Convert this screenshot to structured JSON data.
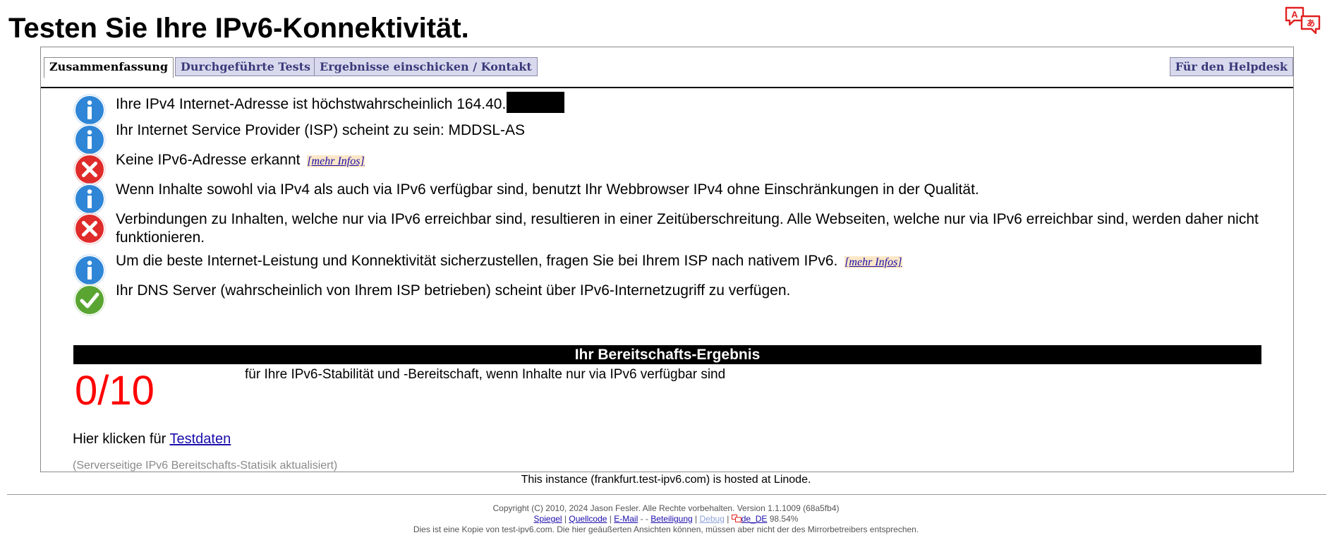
{
  "page": {
    "title": "Testen Sie Ihre IPv6-Konnektivität."
  },
  "icons": {
    "info": "info-icon",
    "error": "error-icon",
    "ok": "check-icon",
    "translate": "translate-icon"
  },
  "colors": {
    "info_blue": "#2f86d6",
    "error_red": "#e02b2b",
    "ok_green": "#5aa532",
    "score_red": "#ff0000",
    "tab_bg": "#d9d9ee",
    "tab_text": "#3a3a7a"
  },
  "tabs": [
    {
      "label": "Zusammenfassung",
      "active": true
    },
    {
      "label": "Durchgeführte Tests",
      "active": false
    },
    {
      "label": "Ergebnisse einschicken / Kontakt",
      "active": false
    }
  ],
  "helpdesk_tab": {
    "label": "Für den Helpdesk"
  },
  "results": [
    {
      "status": "info",
      "text": "Ihre IPv4 Internet-Adresse ist höchstwahrscheinlich 164.40."
    },
    {
      "status": "info",
      "text": "Ihr Internet Service Provider (ISP) scheint zu sein: MDDSL-AS"
    },
    {
      "status": "error",
      "text": "Keine IPv6-Adresse erkannt",
      "link": "[mehr Infos]"
    },
    {
      "status": "info",
      "text": "Wenn Inhalte sowohl via IPv4 als auch via IPv6 verfügbar sind, benutzt Ihr Webbrowser IPv4 ohne Einschränkungen in der Qualität."
    },
    {
      "status": "error",
      "text": "Verbindungen zu Inhalten, welche nur via IPv6 erreichbar sind, resultieren in einer Zeitüberschreitung. Alle Webseiten, welche nur via IPv6 erreichbar sind, werden daher nicht funktionieren."
    },
    {
      "status": "info",
      "text": "Um die beste Internet-Leistung und Konnektivität sicherzustellen, fragen Sie bei Ihrem ISP nach nativem IPv6.",
      "link": "[mehr Infos]"
    },
    {
      "status": "ok",
      "text": "Ihr DNS Server (wahrscheinlich von Ihrem ISP betrieben) scheint über IPv6-Internetzugriff zu verfügen."
    }
  ],
  "score": {
    "header": "Ihr Bereitschafts-Ergebnis",
    "value": "0/10",
    "description": "für Ihre IPv6-Stabilität und -Bereitschaft, wenn Inhalte nur via IPv6 verfügbar sind"
  },
  "testdata": {
    "prefix": "Hier klicken für",
    "link": "Testdaten"
  },
  "stats_note": "(Serverseitige IPv6 Bereitschafts-Statisik aktualisiert)",
  "hosted": "This instance (frankfurt.test-ipv6.com) is hosted at Linode.",
  "footer": {
    "copyright": "Copyright (C) 2010, 2024 Jason Fesler. Alle Rechte vorbehalten. Version 1.1.1009 (68a5fb4)",
    "links": {
      "mirror": "Spiegel",
      "source": "Quellcode",
      "email": "E-Mail",
      "participation": "Beteiligung",
      "debug": "Debug",
      "locale": "de_DE",
      "percent": "98.54%"
    },
    "separator": "|",
    "dash": "-",
    "disclaimer": "Dies ist eine Kopie von test-ipv6.com. Die hier geäußerten Ansichten können, müssen aber nicht der des Mirrorbetreibers entsprechen."
  }
}
